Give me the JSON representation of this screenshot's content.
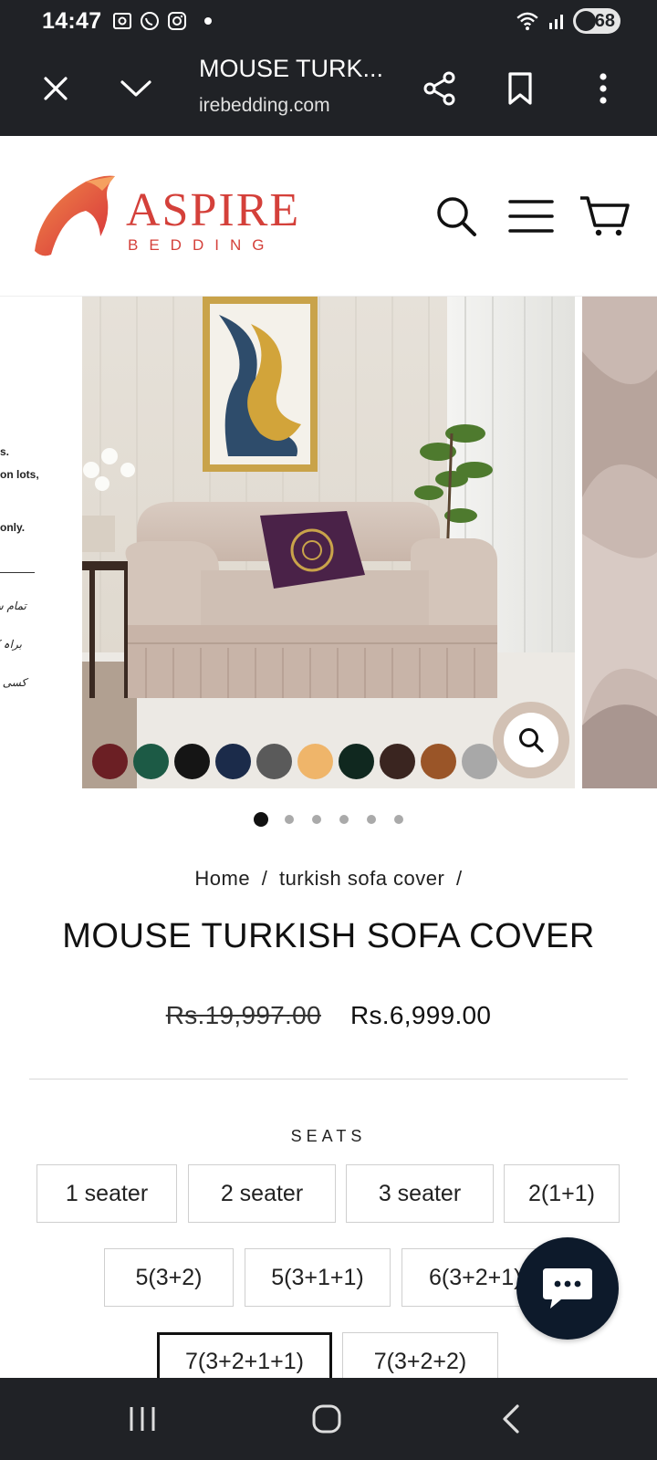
{
  "status_bar": {
    "time": "14:47",
    "battery": "68",
    "icons": [
      "screenshot-icon",
      "whatsapp-icon",
      "instagram-icon",
      "notification-dot",
      "wifi-icon",
      "signal-icon",
      "battery-icon"
    ]
  },
  "browser": {
    "title": "MOUSE TURK...",
    "url": "irebedding.com",
    "close_icon": "close-icon",
    "menu_icon": "chevron-down-icon",
    "share_icon": "share-icon",
    "bookmark_icon": "bookmark-icon",
    "more_icon": "more-vertical-icon"
  },
  "header": {
    "logo_text": "ASPIRE",
    "logo_sub": "BEDDING",
    "brand_color": "#d4403a"
  },
  "gallery": {
    "left_slide_text": [
      "s.",
      "on lots,",
      "only."
    ],
    "left_slide_urdu": [
      "تمام سائز",
      "براہ کرم",
      "کسی بھی"
    ],
    "swatches": [
      "#6b1f24",
      "#1c5a45",
      "#151515",
      "#1b2b4a",
      "#5a5a5a",
      "#efb56a",
      "#10281f",
      "#3a2520",
      "#9a5528",
      "#a8a8a8"
    ],
    "slide_count": 6,
    "active_slide": 1
  },
  "product": {
    "breadcrumb": [
      "Home",
      "/",
      "turkish sofa cover",
      "/"
    ],
    "title": "MOUSE TURKISH SOFA COVER",
    "price_old": "Rs.19,997.00",
    "price_new": "Rs.6,999.00",
    "seats_label": "SEATS",
    "seat_options": [
      "1 seater",
      "2 seater",
      "3 seater",
      "2(1+1)",
      "5(3+2)",
      "5(3+1+1)",
      "6(3+2+1)",
      "7(3+2+1+1)",
      "7(3+2+2)"
    ],
    "selected_option": "7(3+2+1+1)"
  },
  "nav": {
    "recent_icon": "recent-apps-icon",
    "home_icon": "home-icon",
    "back_icon": "back-icon"
  }
}
